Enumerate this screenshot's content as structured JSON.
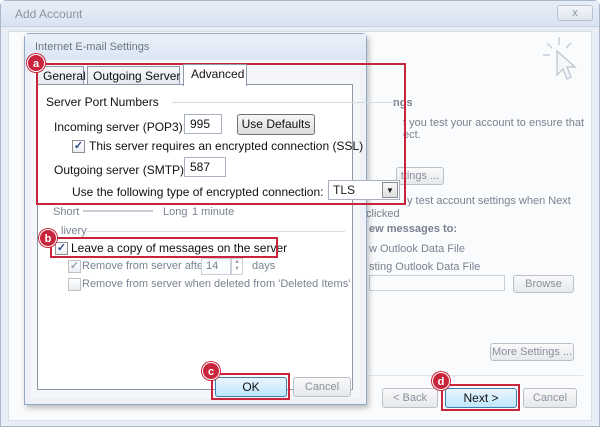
{
  "window": {
    "title": "Add Account",
    "close_label": "x"
  },
  "background": {
    "section_heading_fragment": "ngs",
    "desc_line1": "t you test your account to ensure that",
    "desc_line2": "ect.",
    "test_button": "ttings ...",
    "auto_test_line1": "y test account settings when Next",
    "auto_test_line2": "clicked",
    "deliver_heading": "ew messages to:",
    "radio_new": "w Outlook Data File",
    "radio_existing": "sting Outlook Data File",
    "browse_button": "Browse",
    "more_settings_button": "More Settings ...",
    "back_button": "< Back",
    "next_button": "Next >",
    "cancel_button": "Cancel"
  },
  "dialog": {
    "title": "Internet E-mail Settings",
    "tabs": [
      "General",
      "Outgoing Server",
      "Advanced"
    ],
    "active_tab": "Advanced",
    "server_port_numbers": "Server Port Numbers",
    "incoming_label": "Incoming server (POP3):",
    "incoming_value": "995",
    "use_defaults": "Use Defaults",
    "ssl_label": "This server requires an encrypted connection (SSL)",
    "ssl_checked": true,
    "outgoing_label": "Outgoing server (SMTP):",
    "outgoing_value": "587",
    "encryption_label": "Use the following type of encrypted connection:",
    "encryption_value": "TLS",
    "timeout_short": "Short",
    "timeout_long": "Long",
    "timeout_value": "1 minute",
    "delivery_fragment": "livery",
    "leave_copy": "Leave a copy of messages on the server",
    "leave_copy_checked": true,
    "remove_after": "Remove from server after",
    "remove_days_value": "14",
    "days": "days",
    "remove_deleted": "Remove from server when deleted from 'Deleted Items'",
    "ok_button": "OK",
    "cancel_button": "Cancel"
  },
  "callouts": {
    "a": "a",
    "b": "b",
    "c": "c",
    "d": "d"
  },
  "colors": {
    "callout_red": "#c8243b",
    "check_blue": "#2d4e89"
  }
}
